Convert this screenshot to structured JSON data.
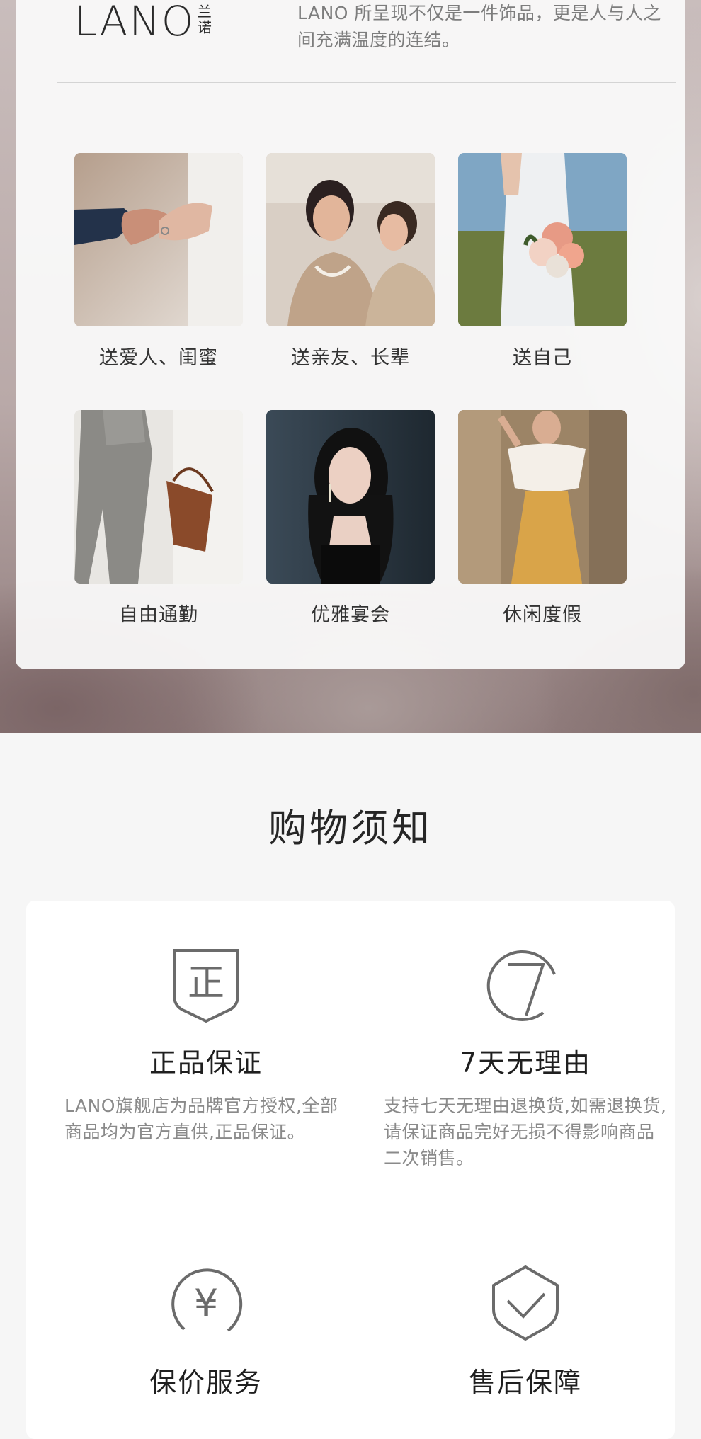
{
  "brand": {
    "logo_text": "LANO",
    "logo_cn": "兰诺"
  },
  "intro": {
    "text": "我们更注重客户们的内心世界和自我馈赠LANO 所呈现不仅是一件饰品，更是人与人之间充满温度的连结。"
  },
  "occasions": [
    {
      "label": "送爱人、闺蜜",
      "image": "holding-hands-photo"
    },
    {
      "label": "送亲友、长辈",
      "image": "mother-daughter-photo"
    },
    {
      "label": "送自己",
      "image": "bride-bouquet-photo"
    },
    {
      "label": "自由通勤",
      "image": "commute-handbag-photo"
    },
    {
      "label": "优雅宴会",
      "image": "evening-portrait-photo"
    },
    {
      "label": "休闲度假",
      "image": "vacation-outfit-photo"
    }
  ],
  "notice": {
    "title": "购物须知",
    "items": [
      {
        "icon": "authentic-shield-icon",
        "icon_char": "正",
        "title": "正品保证",
        "desc": "LANO旗舰店为品牌官方授权,全部商品均为官方直供,正品保证。"
      },
      {
        "icon": "seven-day-icon",
        "icon_char": "7",
        "title": "7天无理由",
        "desc": "支持七天无理由退换货,如需退换货,请保证商品完好无损不得影响商品二次销售。"
      },
      {
        "icon": "yuan-price-icon",
        "icon_char": "¥",
        "title": "保价服务",
        "desc": ""
      },
      {
        "icon": "checkmark-shield-icon",
        "icon_char": "",
        "title": "售后保障",
        "desc": ""
      }
    ]
  },
  "colors": {
    "card_bg": "#fafafa",
    "icon_stroke": "#6b6b6b",
    "title_text": "#262626",
    "desc_text": "#8a8a8a"
  }
}
